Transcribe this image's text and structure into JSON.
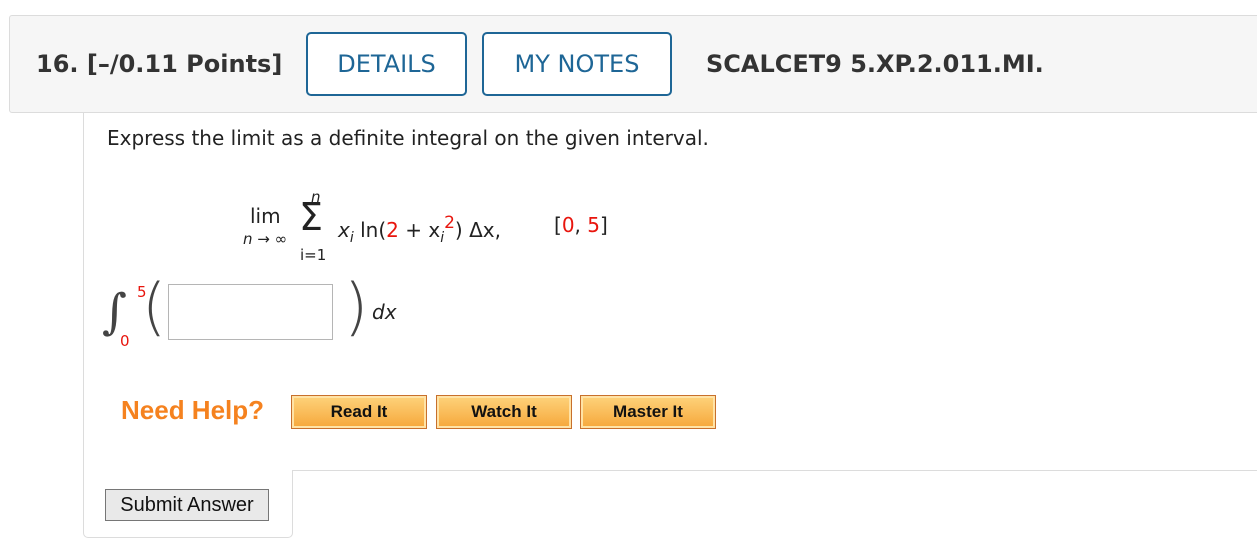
{
  "header": {
    "question_label": "16.  [–/0.11 Points]",
    "details_label": "DETAILS",
    "notes_label": "MY NOTES",
    "problem_code": "SCALCET9 5.XP.2.011.MI."
  },
  "question": {
    "prompt": "Express the limit as a definite integral on the given interval.",
    "limit": {
      "lim": "lim",
      "lim_sub": "n → ∞",
      "sigma": "Σ",
      "sum_upper": "n",
      "sum_lower": "i=1",
      "x_i": "x",
      "i_sub": "i",
      "ln_open": "ln(",
      "two": "2",
      "plus_x": " + x",
      "i_sub2": "i",
      "sq": "2",
      "close_dx": ") Δx,",
      "interval_open": "[",
      "a": "0",
      "comma": ", ",
      "b": "5",
      "interval_close": "]"
    },
    "integral": {
      "sign": "∫",
      "upper": "5",
      "lower": "0",
      "open_paren": "(",
      "close_paren": ")",
      "dx": "dx",
      "answer_value": ""
    }
  },
  "help": {
    "label": "Need Help?",
    "read": "Read It",
    "watch": "Watch It",
    "master": "Master It"
  },
  "submit_label": "Submit Answer",
  "colors": {
    "accent_blue": "#1e6696",
    "need_help_orange": "#f5821f",
    "highlight_red": "#e8150d"
  }
}
